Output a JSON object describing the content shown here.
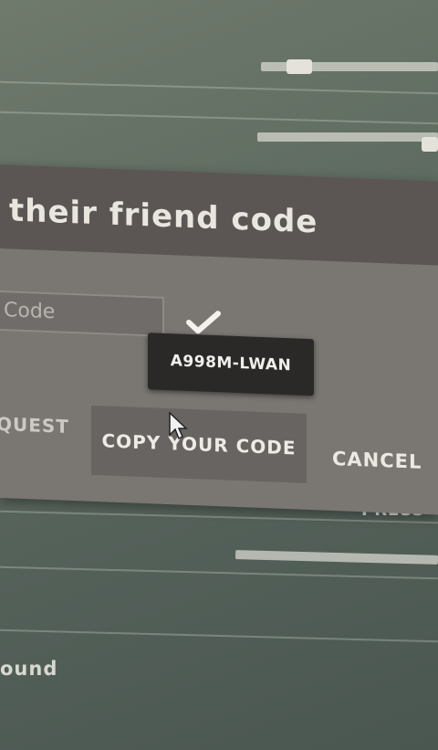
{
  "dialog": {
    "title": "their friend code",
    "code_input": {
      "placeholder": "Code",
      "value": ""
    },
    "tooltip_code": "A998M-LWAN",
    "buttons": {
      "request": "QUEST",
      "copy": "COPY YOUR CODE",
      "cancel": "CANCEL"
    }
  },
  "background": {
    "partial_label_right": "PRESS",
    "partial_label_left": "ound"
  },
  "icons": {
    "check": "check-icon",
    "cursor": "mouse-cursor-icon"
  },
  "colors": {
    "dialog_body": "#7a7672",
    "dialog_header": "#5b5653",
    "tooltip_bg": "#2b2928",
    "text_light": "#e9e6e0"
  }
}
